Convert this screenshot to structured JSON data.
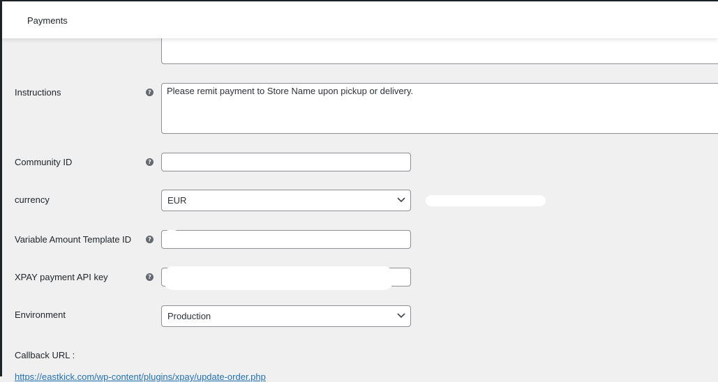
{
  "header": {
    "title": "Payments"
  },
  "fields": {
    "instructions": {
      "label": "Instructions",
      "value": "Please remit payment to Store Name upon pickup or delivery."
    },
    "community_id": {
      "label": "Community ID",
      "value": ""
    },
    "currency": {
      "label": "currency",
      "value": "EUR"
    },
    "variable_amount_template_id": {
      "label": "Variable Amount Template ID",
      "value": ""
    },
    "xpay_api_key": {
      "label": "XPAY payment API key",
      "value": ""
    },
    "environment": {
      "label": "Environment",
      "value": "Production"
    }
  },
  "callback": {
    "label": "Callback URL :",
    "url": "https://eastkick.com/wp-content/plugins/xpay/update-order.php"
  },
  "icons": {
    "help": "help-question-icon",
    "dropdown": "chevron-down-icon"
  },
  "colors": {
    "background": "#f0f0f1",
    "link": "#2271b1",
    "help_icon": "#646970"
  }
}
